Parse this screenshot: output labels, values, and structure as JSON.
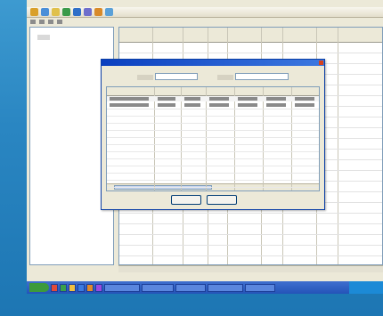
{
  "app": {
    "title": "",
    "menu": [
      "",
      "",
      "",
      "",
      "",
      "",
      "",
      "",
      ""
    ]
  },
  "toolbar": {
    "buttons": [
      {
        "icon": "toolbar-icon",
        "color": "#d9a02a"
      },
      {
        "icon": "toolbar-icon",
        "color": "#4a8fd8"
      },
      {
        "icon": "toolbar-icon",
        "color": "#e0c04a"
      },
      {
        "icon": "toolbar-icon",
        "color": "#3a9a4a"
      },
      {
        "icon": "toolbar-icon",
        "color": "#2f6fc8"
      },
      {
        "icon": "toolbar-icon",
        "color": "#6e6ecc"
      },
      {
        "icon": "toolbar-icon",
        "color": "#d88a2a"
      },
      {
        "icon": "toolbar-icon",
        "color": "#5aa0d8"
      }
    ]
  },
  "tree": {
    "root_label": ""
  },
  "grid": {
    "columns": [
      "",
      "",
      "",
      "",
      "",
      "",
      "",
      "",
      ""
    ],
    "row_count": 20
  },
  "dialog": {
    "title": "",
    "field1": {
      "label": "",
      "value": ""
    },
    "field2": {
      "label": "",
      "value": ""
    },
    "table": {
      "columns": [
        "",
        "",
        "",
        "",
        "",
        "",
        ""
      ],
      "rows": [
        [
          "",
          "",
          "",
          "",
          "",
          "",
          ""
        ],
        [
          "",
          "",
          "",
          "",
          "",
          "",
          ""
        ]
      ]
    },
    "ok_label": "",
    "cancel_label": ""
  },
  "taskbar": {
    "items": [
      "",
      "",
      "",
      "",
      "",
      "",
      "",
      ""
    ]
  },
  "colors": {
    "desktop": "#2a86c2",
    "titlebar": "#0a52c6",
    "dialog_border": "#0b3fa6",
    "taskbar": "#2453b8"
  }
}
